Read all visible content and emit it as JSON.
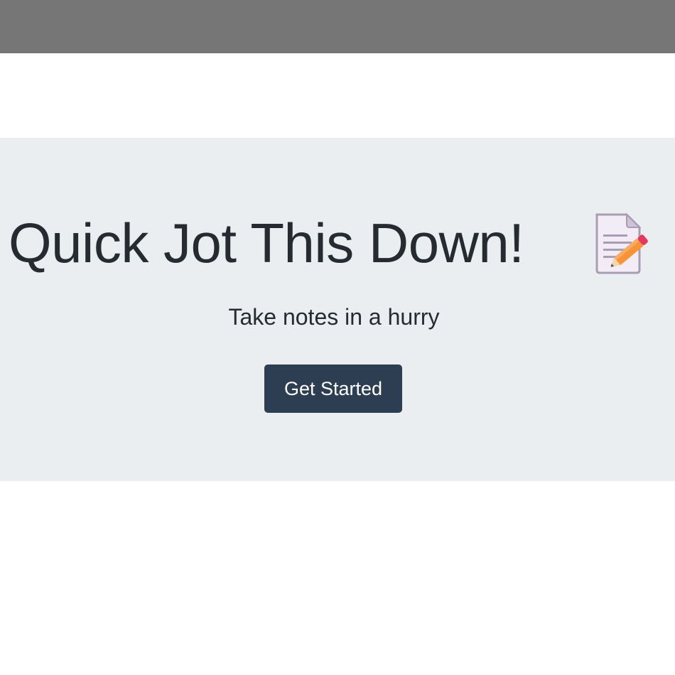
{
  "hero": {
    "title": "Quick Jot This Down!",
    "title_icon": "memo-icon",
    "subtitle": "Take notes in a hurry",
    "cta_label": "Get Started"
  },
  "colors": {
    "top_bar": "#767676",
    "hero_background": "#ebeef0",
    "text": "#262b31",
    "button_background": "#2e3e52",
    "button_text": "#ffffff"
  }
}
